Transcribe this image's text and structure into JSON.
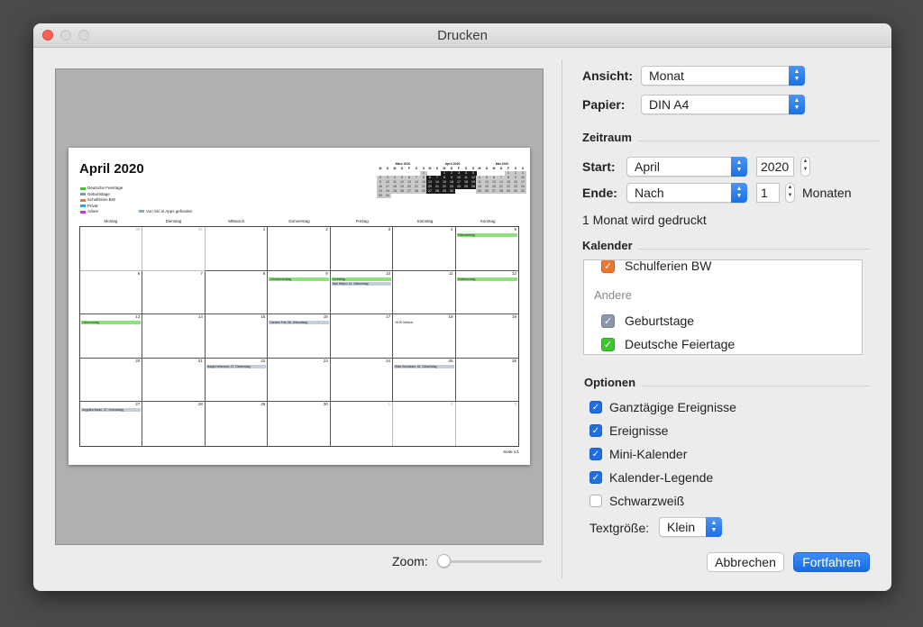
{
  "window": {
    "title": "Drucken"
  },
  "preview": {
    "month_title": "April 2020",
    "legend": [
      {
        "label": "Deutsche Feiertage",
        "color": "#3ec62e"
      },
      {
        "label": "Geburtstage",
        "color": "#8b96a8"
      },
      {
        "label": "Schulferien BW",
        "color": "#f0762f"
      },
      {
        "label": "Privat",
        "color": "#1fa5e8"
      },
      {
        "label": "Arbeit",
        "color": "#c13ad4"
      }
    ],
    "legend_siri": {
      "label": "Von Siri in Apps gefunden",
      "color": "#8fa7c4"
    },
    "minicals": [
      {
        "title": "März 2020",
        "style": "grey",
        "header": [
          "M",
          "D",
          "M",
          "D",
          "F",
          "S",
          "S"
        ],
        "rows": [
          [
            "",
            "",
            "",
            "",
            "",
            "",
            "1"
          ],
          [
            "2",
            "3",
            "4",
            "5",
            "6",
            "7",
            "8"
          ],
          [
            "9",
            "10",
            "11",
            "12",
            "13",
            "14",
            "15"
          ],
          [
            "16",
            "17",
            "18",
            "19",
            "20",
            "21",
            "22"
          ],
          [
            "23",
            "24",
            "25",
            "26",
            "27",
            "28",
            "29"
          ],
          [
            "30",
            "31",
            "",
            "",
            "",
            "",
            ""
          ]
        ]
      },
      {
        "title": "April 2020",
        "style": "black",
        "header": [
          "M",
          "D",
          "M",
          "D",
          "F",
          "S",
          "S"
        ],
        "rows": [
          [
            "",
            "",
            "1",
            "2",
            "3",
            "4",
            "5"
          ],
          [
            "6",
            "7",
            "8",
            "9",
            "10",
            "11",
            "12"
          ],
          [
            "13",
            "14",
            "15",
            "16",
            "17",
            "18",
            "19"
          ],
          [
            "20",
            "21",
            "22",
            "23",
            "24",
            "25",
            "26"
          ],
          [
            "27",
            "28",
            "29",
            "30",
            "",
            "",
            ""
          ]
        ]
      },
      {
        "title": "Mai 2020",
        "style": "grey",
        "header": [
          "M",
          "D",
          "M",
          "D",
          "F",
          "S",
          "S"
        ],
        "rows": [
          [
            "",
            "",
            "",
            "",
            "1",
            "2",
            "3"
          ],
          [
            "4",
            "5",
            "6",
            "7",
            "8",
            "9",
            "10"
          ],
          [
            "11",
            "12",
            "13",
            "14",
            "15",
            "16",
            "17"
          ],
          [
            "18",
            "19",
            "20",
            "21",
            "22",
            "23",
            "24"
          ],
          [
            "25",
            "26",
            "27",
            "28",
            "29",
            "30",
            "31"
          ]
        ]
      }
    ],
    "weekdays": [
      "Montag",
      "Dienstag",
      "Mittwoch",
      "Donnerstag",
      "Freitag",
      "Samstag",
      "Sonntag"
    ],
    "days": [
      {
        "d": "30",
        "other": true,
        "events": []
      },
      {
        "d": "31",
        "other": true,
        "events": []
      },
      {
        "d": "1",
        "events": []
      },
      {
        "d": "2",
        "events": []
      },
      {
        "d": "3",
        "events": []
      },
      {
        "d": "4",
        "events": []
      },
      {
        "d": "5",
        "events": [
          {
            "t": "Palmsonntag",
            "c": "g"
          }
        ]
      },
      {
        "d": "6",
        "events": []
      },
      {
        "d": "7",
        "events": []
      },
      {
        "d": "8",
        "events": []
      },
      {
        "d": "9",
        "events": [
          {
            "t": "Gründonnerstag",
            "c": "g"
          }
        ]
      },
      {
        "d": "10",
        "events": [
          {
            "t": "Karfreitag",
            "c": "g"
          },
          {
            "t": "Max Meyer, 41. Geburtstag",
            "c": "b"
          }
        ]
      },
      {
        "d": "11",
        "events": []
      },
      {
        "d": "12",
        "events": [
          {
            "t": "Ostersonntag",
            "c": "g"
          }
        ]
      },
      {
        "d": "13",
        "events": [
          {
            "t": "Ostermontag",
            "c": "g"
          }
        ]
      },
      {
        "d": "14",
        "events": []
      },
      {
        "d": "15",
        "events": []
      },
      {
        "d": "16",
        "events": [
          {
            "t": "Carsten Frei, 56. Geburtstag",
            "c": "b"
          }
        ]
      },
      {
        "d": "17",
        "events": []
      },
      {
        "d": "18",
        "events": [
          {
            "t": "18:00 Markus",
            "c": "t"
          }
        ]
      },
      {
        "d": "19",
        "events": []
      },
      {
        "d": "20",
        "events": []
      },
      {
        "d": "21",
        "events": []
      },
      {
        "d": "22",
        "events": [
          {
            "t": "Nadja Herbrecht, 27. Geburtstag",
            "c": "b"
          }
        ]
      },
      {
        "d": "23",
        "events": []
      },
      {
        "d": "24",
        "events": []
      },
      {
        "d": "25",
        "events": [
          {
            "t": "Silke Schneider, 42. Geburtstag",
            "c": "b"
          }
        ]
      },
      {
        "d": "26",
        "events": []
      },
      {
        "d": "27",
        "events": [
          {
            "t": "Angelika Bauer, 37. Geburtstag",
            "c": "b"
          }
        ]
      },
      {
        "d": "28",
        "events": []
      },
      {
        "d": "29",
        "events": []
      },
      {
        "d": "30",
        "events": []
      },
      {
        "d": "1",
        "other": true,
        "events": []
      },
      {
        "d": "2",
        "other": true,
        "events": []
      },
      {
        "d": "3",
        "other": true,
        "events": []
      }
    ],
    "page_number": "Seite 1/1"
  },
  "zoom": {
    "label": "Zoom:",
    "value": 0
  },
  "settings": {
    "ansicht_label": "Ansicht:",
    "ansicht_value": "Monat",
    "papier_label": "Papier:",
    "papier_value": "DIN A4",
    "zeitraum_heading": "Zeitraum",
    "start_label": "Start:",
    "start_month": "April",
    "start_year": "2020",
    "ende_label": "Ende:",
    "ende_value": "Nach",
    "ende_count": "1",
    "ende_unit": "Monaten",
    "summary": "1 Monat wird gedruckt",
    "kalender_heading": "Kalender",
    "calendars": [
      {
        "label": "Schulferien BW",
        "checked": true,
        "color": "orange"
      },
      {
        "label": "Geburtstage",
        "checked": true,
        "color": "grey"
      },
      {
        "label": "Deutsche Feiertage",
        "checked": true,
        "color": "green"
      }
    ],
    "andere_label": "Andere",
    "optionen_heading": "Optionen",
    "options": [
      {
        "label": "Ganztägige Ereignisse",
        "checked": true
      },
      {
        "label": "Ereignisse",
        "checked": true
      },
      {
        "label": "Mini-Kalender",
        "checked": true
      },
      {
        "label": "Kalender-Legende",
        "checked": true
      },
      {
        "label": "Schwarzweiß",
        "checked": false
      }
    ],
    "textgroesse_label": "Textgröße:",
    "textgroesse_value": "Klein"
  },
  "buttons": {
    "cancel": "Abbrechen",
    "continue": "Fortfahren"
  }
}
